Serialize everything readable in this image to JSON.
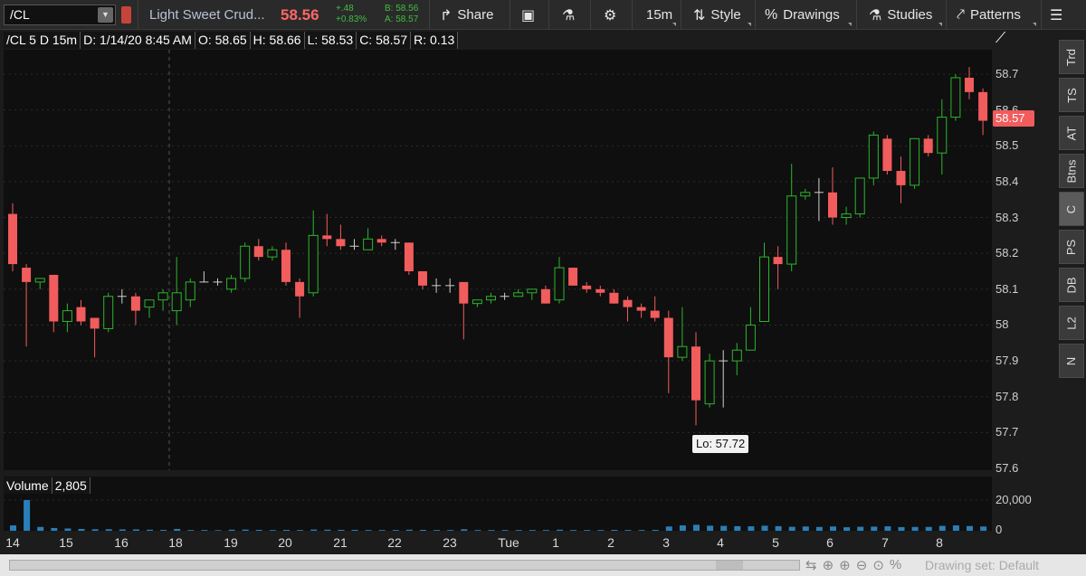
{
  "toolbar": {
    "symbol": "/CL",
    "description": "Light Sweet Crud...",
    "last": "58.56",
    "change": "+.48",
    "change_pct": "+0.83%",
    "bid": "B: 58.56",
    "ask": "A: 58.57",
    "share_label": "Share",
    "interval_label": "15m",
    "style_label": "Style",
    "drawings_label": "Drawings",
    "studies_label": "Studies",
    "patterns_label": "Patterns"
  },
  "infobar": {
    "symbol": "/CL 5 D 15m",
    "date": "D: 1/14/20 8:45 AM",
    "open": "O: 58.65",
    "high": "H: 58.66",
    "low": "L: 58.53",
    "close": "C: 58.57",
    "range": "R: 0.13"
  },
  "price_axis": [
    "58.7",
    "58.6",
    "58.5",
    "58.4",
    "58.3",
    "58.2",
    "58.1",
    "58",
    "57.9",
    "57.8",
    "57.7",
    "57.6"
  ],
  "last_price_tag": "58.57",
  "lo_tag": "Lo: 57.72",
  "volume": {
    "label": "Volume",
    "value": "2,805",
    "axis_top": "20,000",
    "axis_bottom": "0"
  },
  "time_axis": [
    "14",
    "15",
    "16",
    "18",
    "19",
    "20",
    "21",
    "22",
    "23",
    "Tue",
    "1",
    "2",
    "3",
    "4",
    "5",
    "6",
    "7",
    "8"
  ],
  "right_tabs": [
    "Trd",
    "TS",
    "AT",
    "Btns",
    "C",
    "PS",
    "DB",
    "L2",
    "N"
  ],
  "bottom": {
    "drawing_set": "Drawing set: Default"
  },
  "colors": {
    "up": "#2db52d",
    "down": "#f15c5c",
    "volume": "#2a7fb8",
    "background": "#0f0f0f"
  },
  "chart_data": {
    "type": "candlestick",
    "interval": "15m",
    "ylim": [
      57.6,
      58.75
    ],
    "volume_ylim": [
      0,
      20000
    ],
    "candles": [
      {
        "o": 58.31,
        "h": 58.34,
        "l": 58.15,
        "c": 58.17
      },
      {
        "o": 58.16,
        "h": 58.17,
        "l": 57.94,
        "c": 58.12
      },
      {
        "o": 58.12,
        "h": 58.13,
        "l": 58.1,
        "c": 58.13
      },
      {
        "o": 58.14,
        "h": 58.14,
        "l": 57.98,
        "c": 58.01
      },
      {
        "o": 58.01,
        "h": 58.06,
        "l": 57.98,
        "c": 58.04
      },
      {
        "o": 58.05,
        "h": 58.07,
        "l": 58.0,
        "c": 58.01
      },
      {
        "o": 58.02,
        "h": 58.02,
        "l": 57.91,
        "c": 57.99
      },
      {
        "o": 57.99,
        "h": 58.09,
        "l": 57.98,
        "c": 58.08
      },
      {
        "o": 58.08,
        "h": 58.1,
        "l": 58.06,
        "c": 58.08
      },
      {
        "o": 58.08,
        "h": 58.09,
        "l": 58.0,
        "c": 58.04
      },
      {
        "o": 58.05,
        "h": 58.07,
        "l": 58.02,
        "c": 58.07
      },
      {
        "o": 58.07,
        "h": 58.1,
        "l": 58.04,
        "c": 58.09
      },
      {
        "o": 58.04,
        "h": 58.19,
        "l": 58.0,
        "c": 58.09
      },
      {
        "o": 58.07,
        "h": 58.13,
        "l": 58.05,
        "c": 58.12
      },
      {
        "o": 58.12,
        "h": 58.15,
        "l": 58.12,
        "c": 58.12
      },
      {
        "o": 58.12,
        "h": 58.13,
        "l": 58.11,
        "c": 58.12
      },
      {
        "o": 58.1,
        "h": 58.14,
        "l": 58.09,
        "c": 58.13
      },
      {
        "o": 58.13,
        "h": 58.23,
        "l": 58.12,
        "c": 58.22
      },
      {
        "o": 58.22,
        "h": 58.24,
        "l": 58.18,
        "c": 58.19
      },
      {
        "o": 58.19,
        "h": 58.22,
        "l": 58.18,
        "c": 58.21
      },
      {
        "o": 58.21,
        "h": 58.23,
        "l": 58.11,
        "c": 58.12
      },
      {
        "o": 58.12,
        "h": 58.13,
        "l": 58.02,
        "c": 58.08
      },
      {
        "o": 58.09,
        "h": 58.32,
        "l": 58.08,
        "c": 58.25
      },
      {
        "o": 58.25,
        "h": 58.31,
        "l": 58.22,
        "c": 58.24
      },
      {
        "o": 58.24,
        "h": 58.28,
        "l": 58.21,
        "c": 58.22
      },
      {
        "o": 58.22,
        "h": 58.24,
        "l": 58.21,
        "c": 58.22
      },
      {
        "o": 58.21,
        "h": 58.27,
        "l": 58.21,
        "c": 58.24
      },
      {
        "o": 58.24,
        "h": 58.25,
        "l": 58.22,
        "c": 58.23
      },
      {
        "o": 58.23,
        "h": 58.24,
        "l": 58.21,
        "c": 58.23
      },
      {
        "o": 58.23,
        "h": 58.23,
        "l": 58.14,
        "c": 58.15
      },
      {
        "o": 58.15,
        "h": 58.15,
        "l": 58.1,
        "c": 58.11
      },
      {
        "o": 58.11,
        "h": 58.13,
        "l": 58.09,
        "c": 58.11
      },
      {
        "o": 58.11,
        "h": 58.13,
        "l": 58.09,
        "c": 58.11
      },
      {
        "o": 58.12,
        "h": 58.12,
        "l": 57.96,
        "c": 58.06
      },
      {
        "o": 58.06,
        "h": 58.07,
        "l": 58.05,
        "c": 58.07
      },
      {
        "o": 58.07,
        "h": 58.09,
        "l": 58.06,
        "c": 58.08
      },
      {
        "o": 58.08,
        "h": 58.09,
        "l": 58.07,
        "c": 58.08
      },
      {
        "o": 58.08,
        "h": 58.1,
        "l": 58.08,
        "c": 58.09
      },
      {
        "o": 58.09,
        "h": 58.1,
        "l": 58.07,
        "c": 58.1
      },
      {
        "o": 58.1,
        "h": 58.11,
        "l": 58.06,
        "c": 58.06
      },
      {
        "o": 58.07,
        "h": 58.19,
        "l": 58.06,
        "c": 58.16
      },
      {
        "o": 58.16,
        "h": 58.16,
        "l": 58.11,
        "c": 58.11
      },
      {
        "o": 58.11,
        "h": 58.12,
        "l": 58.09,
        "c": 58.1
      },
      {
        "o": 58.1,
        "h": 58.11,
        "l": 58.08,
        "c": 58.09
      },
      {
        "o": 58.09,
        "h": 58.1,
        "l": 58.06,
        "c": 58.06
      },
      {
        "o": 58.07,
        "h": 58.08,
        "l": 58.01,
        "c": 58.05
      },
      {
        "o": 58.05,
        "h": 58.06,
        "l": 58.02,
        "c": 58.04
      },
      {
        "o": 58.04,
        "h": 58.08,
        "l": 58.01,
        "c": 58.02
      },
      {
        "o": 58.02,
        "h": 58.04,
        "l": 57.81,
        "c": 57.91
      },
      {
        "o": 57.91,
        "h": 58.05,
        "l": 57.9,
        "c": 57.94
      },
      {
        "o": 57.94,
        "h": 57.98,
        "l": 57.72,
        "c": 57.79
      },
      {
        "o": 57.78,
        "h": 57.92,
        "l": 57.77,
        "c": 57.9
      },
      {
        "o": 57.9,
        "h": 57.93,
        "l": 57.77,
        "c": 57.9
      },
      {
        "o": 57.9,
        "h": 57.95,
        "l": 57.86,
        "c": 57.93
      },
      {
        "o": 57.93,
        "h": 58.05,
        "l": 57.93,
        "c": 58.0
      },
      {
        "o": 58.01,
        "h": 58.23,
        "l": 58.01,
        "c": 58.19
      },
      {
        "o": 58.19,
        "h": 58.22,
        "l": 58.1,
        "c": 58.17
      },
      {
        "o": 58.17,
        "h": 58.45,
        "l": 58.15,
        "c": 58.36
      },
      {
        "o": 58.36,
        "h": 58.38,
        "l": 58.35,
        "c": 58.37
      },
      {
        "o": 58.37,
        "h": 58.41,
        "l": 58.29,
        "c": 58.37
      },
      {
        "o": 58.37,
        "h": 58.44,
        "l": 58.28,
        "c": 58.3
      },
      {
        "o": 58.3,
        "h": 58.33,
        "l": 58.28,
        "c": 58.31
      },
      {
        "o": 58.31,
        "h": 58.41,
        "l": 58.3,
        "c": 58.41
      },
      {
        "o": 58.41,
        "h": 58.54,
        "l": 58.39,
        "c": 58.53
      },
      {
        "o": 58.52,
        "h": 58.53,
        "l": 58.42,
        "c": 58.43
      },
      {
        "o": 58.43,
        "h": 58.47,
        "l": 58.34,
        "c": 58.39
      },
      {
        "o": 58.39,
        "h": 58.52,
        "l": 58.38,
        "c": 58.52
      },
      {
        "o": 58.52,
        "h": 58.53,
        "l": 58.47,
        "c": 58.48
      },
      {
        "o": 58.48,
        "h": 58.63,
        "l": 58.42,
        "c": 58.58
      },
      {
        "o": 58.58,
        "h": 58.7,
        "l": 58.57,
        "c": 58.69
      },
      {
        "o": 58.69,
        "h": 58.72,
        "l": 58.63,
        "c": 58.65
      },
      {
        "o": 58.65,
        "h": 58.66,
        "l": 58.53,
        "c": 58.57
      }
    ],
    "volumes": [
      3500,
      20000,
      2500,
      1800,
      1500,
      1200,
      1000,
      1000,
      900,
      900,
      700,
      600,
      1200,
      500,
      500,
      400,
      700,
      800,
      600,
      500,
      600,
      500,
      800,
      700,
      600,
      600,
      500,
      500,
      500,
      700,
      600,
      500,
      500,
      1000,
      500,
      500,
      500,
      500,
      500,
      500,
      700,
      500,
      500,
      500,
      600,
      500,
      500,
      600,
      2800,
      3500,
      3900,
      3300,
      3200,
      3000,
      2900,
      3300,
      3000,
      2600,
      2800,
      2500,
      2800,
      2300,
      2600,
      2700,
      2900,
      2400,
      2500,
      2500,
      3200,
      3500,
      3100,
      2805
    ]
  }
}
